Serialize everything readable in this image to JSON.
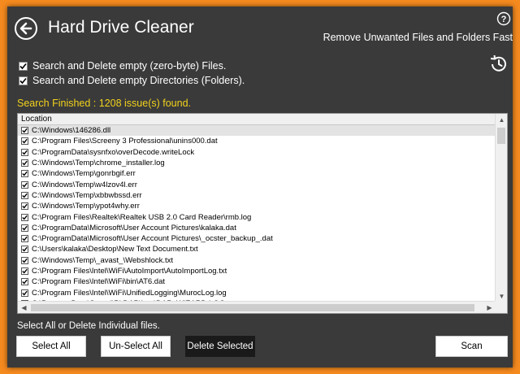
{
  "app": {
    "title": "Hard Drive Cleaner",
    "subtitle": "Remove Unwanted Files and Folders Fast"
  },
  "options": [
    {
      "label": "Search and Delete empty (zero-byte) Files.",
      "checked": true
    },
    {
      "label": "Search and Delete empty Directories (Folders).",
      "checked": true
    }
  ],
  "status": "Search Finished : 1208 issue(s) found.",
  "table": {
    "column": "Location",
    "rows": [
      "C:\\Windows\\146286.dll",
      "C:\\Program Files\\Screeny 3 Professional\\unins000.dat",
      "C:\\ProgramData\\sysnfxo\\overDecode.writeLock",
      "C:\\Windows\\Temp\\chrome_installer.log",
      "C:\\Windows\\Temp\\gonrbgif.err",
      "C:\\Windows\\Temp\\w4lzov4l.err",
      "C:\\Windows\\Temp\\xbbwbssd.err",
      "C:\\Windows\\Temp\\ypot4why.err",
      "C:\\Program Files\\Realtek\\Realtek USB 2.0 Card Reader\\rmb.log",
      "C:\\ProgramData\\Microsoft\\User Account Pictures\\kalaka.dat",
      "C:\\ProgramData\\Microsoft\\User Account Pictures\\_ocster_backup_.dat",
      "C:\\Users\\kalaka\\Desktop\\New Text Document.txt",
      "C:\\Windows\\Temp\\_avast_\\Webshlock.txt",
      "C:\\Program Files\\Intel\\WiFi\\AutoImport\\AutoImportLog.txt",
      "C:\\Program Files\\Intel\\WiFi\\bin\\AT6.dat",
      "C:\\Program Files\\Intel\\WiFi\\UnifiedLogging\\MurocLog.log",
      "C:\\ProgramData\\Speed\\PitDAP\\Log\\DAP_WIZARD.LOG"
    ]
  },
  "hint": "Select All or Delete Individual files.",
  "buttons": {
    "select_all": "Select All",
    "unselect_all": "Un-Select All",
    "delete_selected": "Delete Selected",
    "scan": "Scan"
  },
  "icons": {
    "back": "back-arrow-icon",
    "help": "help-icon",
    "history": "history-icon"
  },
  "colors": {
    "background": "#f58a1f",
    "window": "#3a3a3a",
    "status": "#f2d21b"
  }
}
